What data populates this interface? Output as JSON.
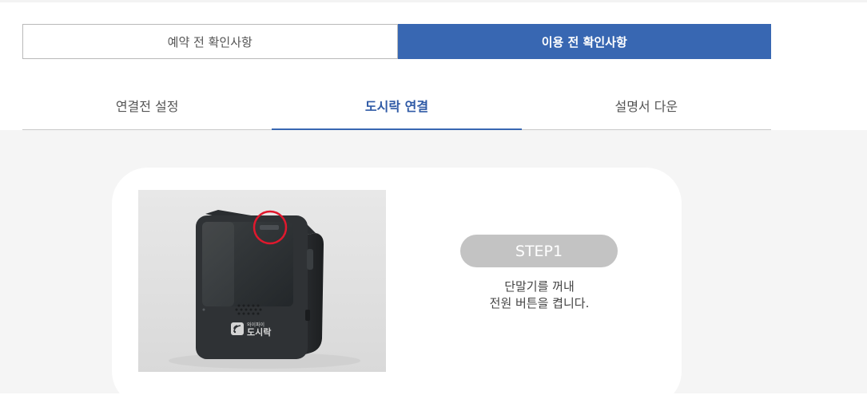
{
  "main_tabs": [
    {
      "label": "예약 전 확인사항"
    },
    {
      "label": "이용 전 확인사항"
    }
  ],
  "sub_tabs": [
    {
      "label": "연결전 설정"
    },
    {
      "label": "도시락 연결"
    },
    {
      "label": "설명서 다운"
    }
  ],
  "step": {
    "badge": "STEP1",
    "line1": "단말기를 꺼내",
    "line2": "전원 버튼을 켭니다."
  },
  "device": {
    "brand_small": "와이파이",
    "brand_main": "도시락"
  },
  "colors": {
    "accent": "#3867b2",
    "highlight_circle": "#e0182d",
    "badge": "#c3c3c3"
  }
}
